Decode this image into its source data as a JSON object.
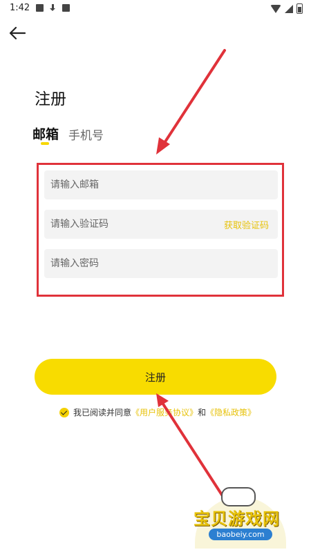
{
  "status_bar": {
    "time": "1:42"
  },
  "page": {
    "title": "注册"
  },
  "tabs": [
    {
      "label": "邮箱",
      "active": true
    },
    {
      "label": "手机号",
      "active": false
    }
  ],
  "form": {
    "email_placeholder": "请输入邮箱",
    "code_placeholder": "请输入验证码",
    "get_code_label": "获取验证码",
    "password_placeholder": "请输入密码"
  },
  "register_button": {
    "label": "注册"
  },
  "agreement": {
    "checked": true,
    "prefix": "我已阅读并同意",
    "user_agreement": "《用户服务协议》",
    "and": "和",
    "privacy_policy": "《隐私政策》"
  },
  "watermark": {
    "title": "宝贝游戏网",
    "url": "baobeiy.com"
  },
  "colors": {
    "accent": "#F8DC00",
    "link": "#E7C20A",
    "annotation": "#E0323A"
  }
}
